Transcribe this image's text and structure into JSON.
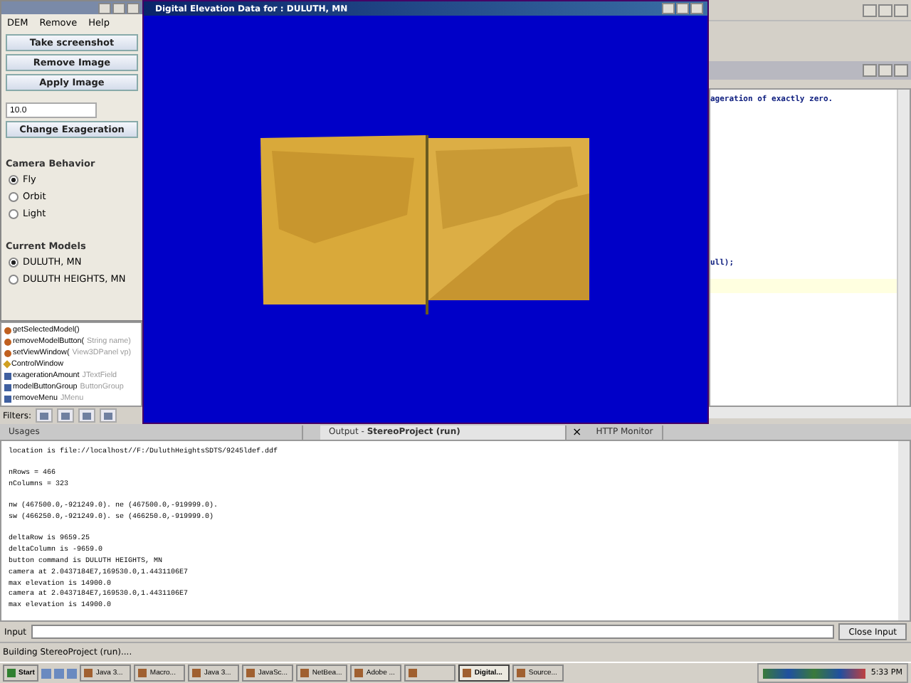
{
  "control_window": {
    "menu": [
      "DEM",
      "Remove",
      "Help"
    ],
    "buttons": [
      "Take screenshot",
      "Remove Image",
      "Apply Image"
    ],
    "exaggeration_value": "10.0",
    "exaggeration_button": "Change Exageration",
    "camera_heading": "Camera Behavior",
    "camera_options": [
      {
        "label": "Fly",
        "selected": true
      },
      {
        "label": "Orbit",
        "selected": false
      },
      {
        "label": "Light",
        "selected": false
      }
    ],
    "models_heading": "Current Models",
    "models": [
      {
        "label": "DULUTH, MN",
        "selected": true
      },
      {
        "label": "DULUTH HEIGHTS, MN",
        "selected": false
      }
    ]
  },
  "navigator": {
    "members": [
      {
        "kind": "method",
        "name": "getSelectedModel()"
      },
      {
        "kind": "method",
        "name": "removeModelButton(",
        "detail": "String name)"
      },
      {
        "kind": "method",
        "name": "setViewWindow(",
        "detail": "View3DPanel vp)"
      },
      {
        "kind": "constructor",
        "name": "ControlWindow"
      },
      {
        "kind": "field",
        "name": "exagerationAmount",
        "detail": "JTextField"
      },
      {
        "kind": "field",
        "name": "modelButtonGroup",
        "detail": "ButtonGroup"
      },
      {
        "kind": "field",
        "name": "removeMenu",
        "detail": "JMenu"
      }
    ],
    "filters_label": "Filters:"
  },
  "dem_window": {
    "title": "Digital Elevation Data for : DULUTH, MN"
  },
  "editor": {
    "lines": [
      {
        "kind": "comment",
        "text": "ageration of exactly zero."
      },
      {
        "kind": "code",
        "text": "ull);"
      }
    ]
  },
  "output": {
    "tabs": [
      {
        "label": "Usages",
        "selected": false
      },
      {
        "label": "Output - **StereoProject (run)**",
        "selected": true
      },
      {
        "label": "HTTP Monitor",
        "selected": false
      }
    ],
    "tab_close": "×",
    "blocks": [
      [
        "location is file://localhost//F:/DuluthHeightsSDTS/9245ldef.ddf"
      ],
      [
        "nRows = 466",
        "nColumns = 323"
      ],
      [
        "nw (467500.0,-921249.0). ne (467500.0,-919999.0).",
        "sw (466250.0,-921249.0). se (466250.0,-919999.0)"
      ],
      [
        "deltaRow is 9659.25",
        "deltaColumn is -9659.0",
        "button command is DULUTH HEIGHTS, MN",
        "camera at 2.0437184E7,169530.0,1.4431106E7",
        "max elevation is 14900.0",
        "camera at 2.0437184E7,169530.0,1.4431106E7",
        "max elevation is 14900.0"
      ]
    ],
    "input_label": "Input",
    "close_button": "Close Input"
  },
  "status_bar": "Building StereoProject (run)....",
  "taskbar": {
    "start": "Start",
    "tasks": [
      {
        "label": "Java 3...",
        "selected": false
      },
      {
        "label": "Macro...",
        "selected": false
      },
      {
        "label": "Java 3...",
        "selected": false
      },
      {
        "label": "JavaSc...",
        "selected": false
      },
      {
        "label": "NetBea...",
        "selected": false
      },
      {
        "label": "Adobe ...",
        "selected": false
      },
      {
        "selected": false
      },
      {
        "label": "Digital...",
        "selected": true
      },
      {
        "label": "Source...",
        "selected": false
      }
    ],
    "clock": "5:33 PM"
  }
}
